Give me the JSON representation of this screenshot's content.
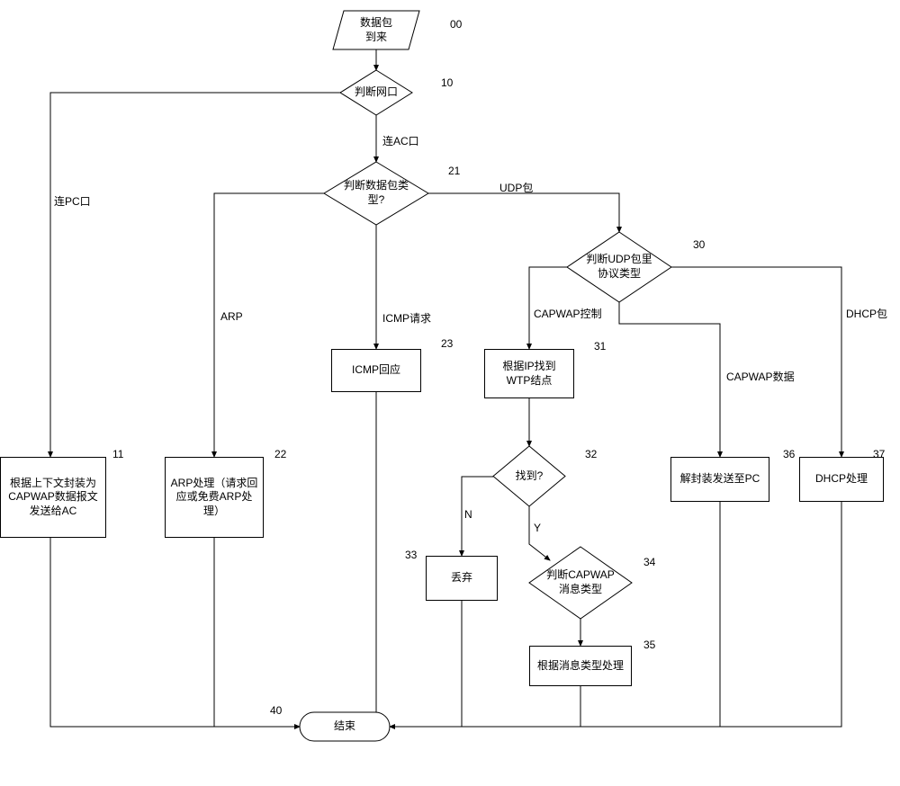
{
  "chart_data": {
    "type": "flowchart",
    "nodes": [
      {
        "id": "00",
        "type": "parallelogram",
        "label": "数据包\n到来",
        "ref": "00"
      },
      {
        "id": "10",
        "type": "diamond",
        "label": "判断网口",
        "ref": "10"
      },
      {
        "id": "21",
        "type": "diamond",
        "label": "判断数据包类\n型?",
        "ref": "21"
      },
      {
        "id": "30",
        "type": "diamond",
        "label": "判断UDP包里\n协议类型",
        "ref": "30"
      },
      {
        "id": "23",
        "type": "rect",
        "label": "ICMP回应",
        "ref": "23"
      },
      {
        "id": "31",
        "type": "rect",
        "label": "根据IP找到\nWTP结点",
        "ref": "31"
      },
      {
        "id": "11",
        "type": "rect",
        "label": "根据上下文封装为\nCAPWAP数据报文\n发送给AC",
        "ref": "11"
      },
      {
        "id": "22",
        "type": "rect",
        "label": "ARP处理（请求回\n应或免费ARP处\n理）",
        "ref": "22"
      },
      {
        "id": "32",
        "type": "diamond",
        "label": "找到?",
        "ref": "32"
      },
      {
        "id": "36",
        "type": "rect",
        "label": "解封装发送至PC",
        "ref": "36"
      },
      {
        "id": "37",
        "type": "rect",
        "label": "DHCP处理",
        "ref": "37"
      },
      {
        "id": "33",
        "type": "rect",
        "label": "丢弃",
        "ref": "33"
      },
      {
        "id": "34",
        "type": "diamond",
        "label": "判断CAPWAP\n消息类型",
        "ref": "34"
      },
      {
        "id": "35",
        "type": "rect",
        "label": "根据消息类型处理",
        "ref": "35"
      },
      {
        "id": "40",
        "type": "terminator",
        "label": "结束",
        "ref": "40"
      }
    ],
    "edges": [
      {
        "from": "00",
        "to": "10"
      },
      {
        "from": "10",
        "to": "11",
        "label": "连PC口"
      },
      {
        "from": "10",
        "to": "21",
        "label": "连AC口"
      },
      {
        "from": "21",
        "to": "22",
        "label": "ARP"
      },
      {
        "from": "21",
        "to": "23",
        "label": "ICMP请求"
      },
      {
        "from": "21",
        "to": "30",
        "label": "UDP包"
      },
      {
        "from": "30",
        "to": "31",
        "label": "CAPWAP控制"
      },
      {
        "from": "30",
        "to": "36",
        "label": "CAPWAP数据"
      },
      {
        "from": "30",
        "to": "37",
        "label": "DHCP包"
      },
      {
        "from": "31",
        "to": "32"
      },
      {
        "from": "32",
        "to": "33",
        "label": "N"
      },
      {
        "from": "32",
        "to": "34",
        "label": "Y"
      },
      {
        "from": "34",
        "to": "35"
      },
      {
        "from": "11",
        "to": "40"
      },
      {
        "from": "22",
        "to": "40"
      },
      {
        "from": "23",
        "to": "40"
      },
      {
        "from": "33",
        "to": "40"
      },
      {
        "from": "35",
        "to": "40"
      },
      {
        "from": "36",
        "to": "40"
      },
      {
        "from": "37",
        "to": "40"
      }
    ]
  },
  "labels": {
    "n00": "数据包\n到来",
    "n10": "判断网口",
    "n21": "判断数据包类\n型?",
    "n30": "判断UDP包里\n协议类型",
    "n23": "ICMP回应",
    "n31": "根据IP找到\nWTP结点",
    "n11": "根据上下文封装为\nCAPWAP数据报文\n发送给AC",
    "n22": "ARP处理（请求回\n应或免费ARP处\n理）",
    "n32": "找到?",
    "n36": "解封装发送至PC",
    "n37": "DHCP处理",
    "n33": "丢弃",
    "n34": "判断CAPWAP\n消息类型",
    "n35": "根据消息类型处理",
    "n40": "结束"
  },
  "refs": {
    "r00": "00",
    "r10": "10",
    "r21": "21",
    "r30": "30",
    "r23": "23",
    "r31": "31",
    "r11": "11",
    "r22": "22",
    "r32": "32",
    "r36": "36",
    "r37": "37",
    "r33": "33",
    "r34": "34",
    "r35": "35",
    "r40": "40"
  },
  "edge_labels": {
    "e_pc": "连PC口",
    "e_ac": "连AC口",
    "e_arp": "ARP",
    "e_icmp": "ICMP请求",
    "e_udp": "UDP包",
    "e_capctrl": "CAPWAP控制",
    "e_capdata": "CAPWAP数据",
    "e_dhcp": "DHCP包",
    "e_n": "N",
    "e_y": "Y"
  }
}
